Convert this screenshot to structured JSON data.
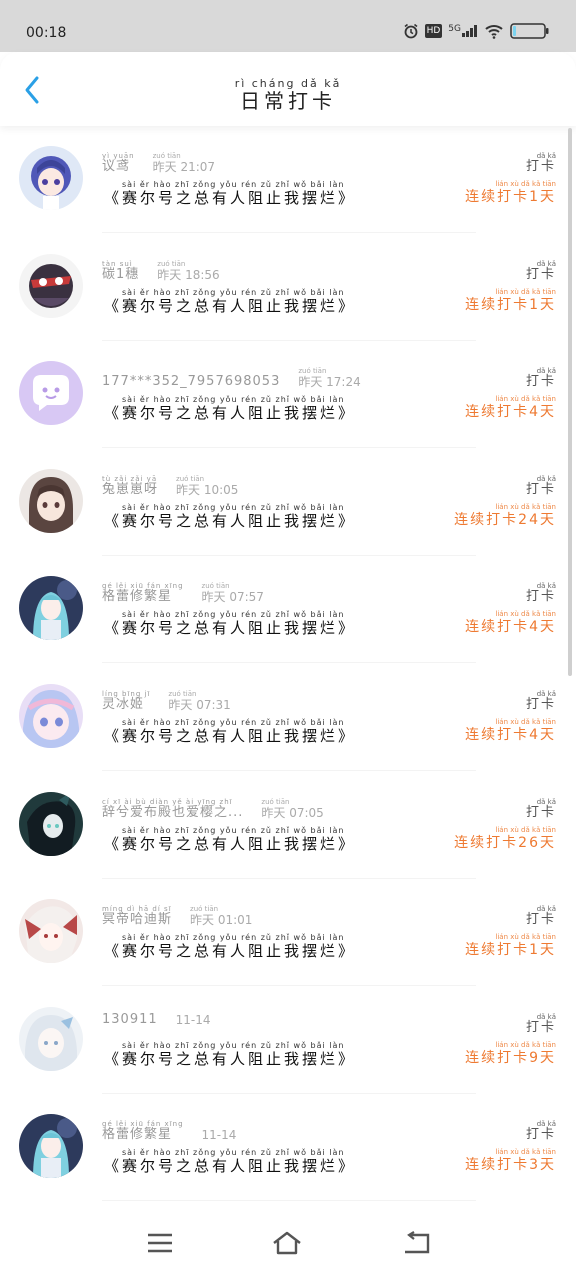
{
  "status_bar": {
    "time": "00:18",
    "network": "5G",
    "hd": "HD"
  },
  "header": {
    "title_pinyin": "rì cháng dǎ kǎ",
    "title": "日常打卡"
  },
  "punch_pinyin": "dǎ kǎ",
  "punch_label": "打卡",
  "message_pinyin": "sài ěr hào zhī zǒng yǒu rén zǔ zhǐ wǒ bǎi làn",
  "entries": [
    {
      "avatar": "avatar-blue-hair-chibi",
      "name_pinyin": "yì yuān",
      "name": "议鸢",
      "time_pinyin": "zuó tiān",
      "time": "昨天 21:07",
      "message": "《赛尔号之总有人阻止我摆烂》",
      "streak_pinyin": "lián xù dǎ kǎ tiān",
      "streak": "连续打卡1天"
    },
    {
      "avatar": "avatar-dark-character",
      "name_pinyin": "tàn suì",
      "name": "碳1穗",
      "time_pinyin": "zuó tiān",
      "time": "昨天 18:56",
      "message": "《赛尔号之总有人阻止我摆烂》",
      "streak_pinyin": "lián xù dǎ kǎ tiān",
      "streak": "连续打卡1天"
    },
    {
      "avatar": "avatar-default-chat",
      "name_pinyin": "",
      "name": "177***352_7957698053",
      "time_pinyin": "zuó tiān",
      "time": "昨天 17:24",
      "message": "《赛尔号之总有人阻止我摆烂》",
      "streak_pinyin": "lián xù dǎ kǎ tiān",
      "streak": "连续打卡4天"
    },
    {
      "avatar": "avatar-brown-hair-girl",
      "name_pinyin": "tù zǎi zǎi yā",
      "name": "兔崽崽呀",
      "time_pinyin": "zuó tiān",
      "time": "昨天 10:05",
      "message": "《赛尔号之总有人阻止我摆烂》",
      "streak_pinyin": "lián xù dǎ kǎ tiān",
      "streak": "连续打卡24天"
    },
    {
      "avatar": "avatar-teal-hair-girl",
      "name_pinyin": "gé lěi xiū fán xīng",
      "name": "格蕾修繁星",
      "time_pinyin": "zuó tiān",
      "time": "昨天 07:57",
      "message": "《赛尔号之总有人阻止我摆烂》",
      "streak_pinyin": "lián xù dǎ kǎ tiān",
      "streak": "连续打卡4天"
    },
    {
      "avatar": "avatar-pastel-girl",
      "name_pinyin": "líng bīng jī",
      "name": "灵冰姬",
      "time_pinyin": "zuó tiān",
      "time": "昨天 07:31",
      "message": "《赛尔号之总有人阻止我摆烂》",
      "streak_pinyin": "lián xù dǎ kǎ tiān",
      "streak": "连续打卡4天"
    },
    {
      "avatar": "avatar-dark-dragon",
      "name_pinyin": "cí xī ài bù diàn yě ài yīng zhī",
      "name": "辞兮爱布殿也爱樱之...",
      "time_pinyin": "zuó tiān",
      "time": "昨天 07:05",
      "message": "《赛尔号之总有人阻止我摆烂》",
      "streak_pinyin": "lián xù dǎ kǎ tiān",
      "streak": "连续打卡26天"
    },
    {
      "avatar": "avatar-white-red-character",
      "name_pinyin": "míng dì hā dí sī",
      "name": "冥帝哈迪斯",
      "time_pinyin": "zuó tiān",
      "time": "昨天 01:01",
      "message": "《赛尔号之总有人阻止我摆烂》",
      "streak_pinyin": "lián xù dǎ kǎ tiān",
      "streak": "连续打卡1天"
    },
    {
      "avatar": "avatar-white-hair-girl",
      "name_pinyin": "",
      "name": "130911",
      "time_pinyin": "",
      "time": "11-14",
      "message": "《赛尔号之总有人阻止我摆烂》",
      "streak_pinyin": "lián xù dǎ kǎ tiān",
      "streak": "连续打卡9天"
    },
    {
      "avatar": "avatar-teal-hair-girl",
      "name_pinyin": "gé lěi xiū fán xīng",
      "name": "格蕾修繁星",
      "time_pinyin": "",
      "time": "11-14",
      "message": "《赛尔号之总有人阻止我摆烂》",
      "streak_pinyin": "lián xù dǎ kǎ tiān",
      "streak": "连续打卡3天"
    }
  ],
  "nav": {
    "menu": "menu-icon",
    "home": "home-icon",
    "back": "back-icon"
  }
}
